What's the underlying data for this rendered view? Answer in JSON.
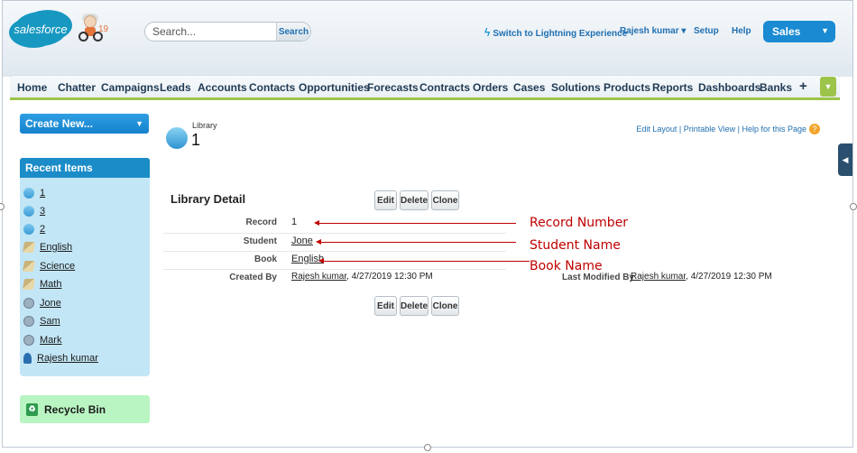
{
  "header": {
    "logo_text": "salesforce",
    "release_badge": "19",
    "search_placeholder": "Search...",
    "search_button": "Search",
    "switch_link": "Switch to Lightning Experience",
    "user_menu": "Rajesh kumar ▾",
    "setup": "Setup",
    "help": "Help",
    "app_menu": "Sales"
  },
  "tabs": [
    "Home",
    "Chatter",
    "Campaigns",
    "Leads",
    "Accounts",
    "Contacts",
    "Opportunities",
    "Forecasts",
    "Contracts",
    "Orders",
    "Cases",
    "Solutions",
    "Products",
    "Reports",
    "Dashboards",
    "Banks"
  ],
  "tab_plus": "+",
  "sidebar": {
    "create_new": "Create New...",
    "recent_heading": "Recent Items",
    "recent_items": [
      {
        "label": "1",
        "icon": "library-icon"
      },
      {
        "label": "3",
        "icon": "library-icon"
      },
      {
        "label": "2",
        "icon": "library-icon"
      },
      {
        "label": "English",
        "icon": "book-icon"
      },
      {
        "label": "Science",
        "icon": "book-icon"
      },
      {
        "label": "Math",
        "icon": "book-icon"
      },
      {
        "label": "Jone",
        "icon": "student-icon"
      },
      {
        "label": "Sam",
        "icon": "student-icon"
      },
      {
        "label": "Mark",
        "icon": "student-icon"
      },
      {
        "label": "Rajesh kumar",
        "icon": "user-icon"
      }
    ],
    "recycle_bin": "Recycle Bin"
  },
  "page": {
    "object_type": "Library",
    "record_title": "1",
    "links": "Edit Layout | Printable View | Help for this Page",
    "detail_heading": "Library Detail",
    "buttons": {
      "edit": "Edit",
      "delete": "Delete",
      "clone": "Clone"
    },
    "fields": {
      "record_label": "Record",
      "record_value": "1",
      "student_label": "Student",
      "student_value": "Jone",
      "book_label": "Book",
      "book_value": "English",
      "created_by_label": "Created By",
      "created_by_user": "Rajesh kumar",
      "created_by_date": ", 4/27/2019 12:30 PM",
      "modified_by_label": "Last Modified By",
      "modified_by_user": "Rajesh kumar",
      "modified_by_date": ", 4/27/2019 12:30 PM"
    }
  },
  "annotations": {
    "record": "Record Number",
    "student": "Student Name",
    "book": "Book Name",
    "color": "#c00000"
  },
  "colors": {
    "tab_accent": "#9cc44a",
    "sidebar_blue": "#1b8cc8",
    "recent_bg": "#c2e6f6",
    "recycle_bg": "#b9f5c2",
    "app_menu": "#1a8ad3"
  }
}
